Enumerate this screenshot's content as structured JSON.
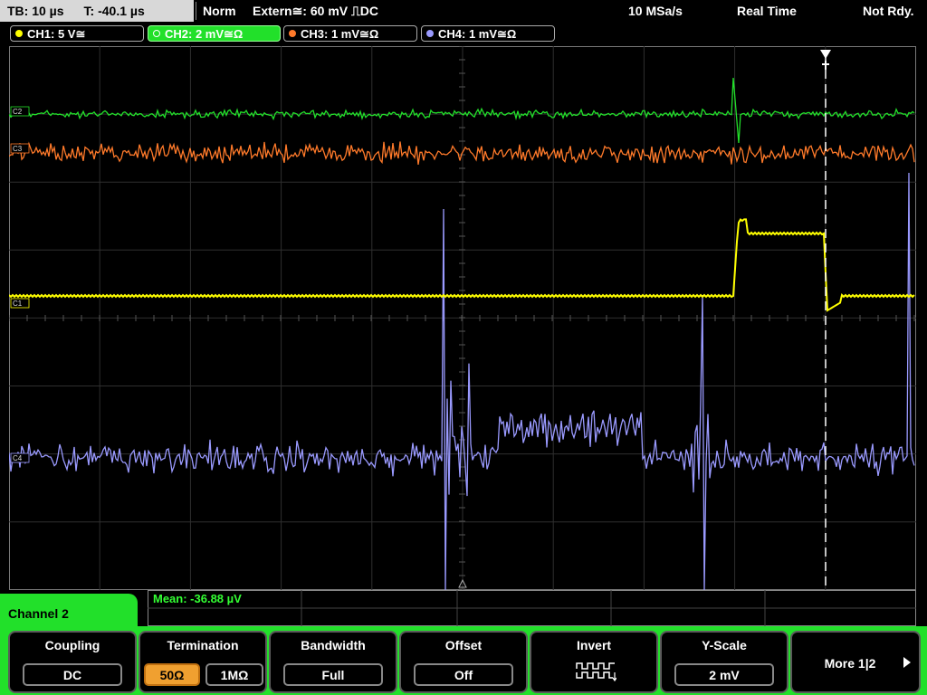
{
  "status": {
    "timebase": "TB: 10 µs",
    "trigger_time": "T: -40.1 µs",
    "mode": "Norm",
    "trigger": "Extern≅: 60 mV ⎍DC",
    "sample_rate": "10 MSa/s",
    "acq_mode": "Real Time",
    "ready": "Not Rdy."
  },
  "channels": [
    {
      "label": "CH1: 5 V≅",
      "color": "#ffff00"
    },
    {
      "label": "CH2: 2 mV≅Ω",
      "color": "#22e02a"
    },
    {
      "label": "CH3: 1 mV≅Ω",
      "color": "#ff7a2a"
    },
    {
      "label": "CH4: 1 mV≅Ω",
      "color": "#9a9aff"
    }
  ],
  "trace_markers": {
    "ch1": "C1",
    "ch2": "C2",
    "ch3": "C3",
    "ch4": "C4"
  },
  "measurement": {
    "text": "Mean: -36.88 µV"
  },
  "menu": {
    "channel_title": "Channel 2",
    "coupling": {
      "title": "Coupling",
      "value": "DC"
    },
    "termination": {
      "title": "Termination",
      "options": [
        "50Ω",
        "1MΩ"
      ],
      "selected": "50Ω"
    },
    "bandwidth": {
      "title": "Bandwidth",
      "value": "Full"
    },
    "offset": {
      "title": "Offset",
      "value": "Off"
    },
    "invert": {
      "title": "Invert"
    },
    "yscale": {
      "title": "Y-Scale",
      "value": "2 mV"
    },
    "more": {
      "title": "More 1|2"
    }
  }
}
